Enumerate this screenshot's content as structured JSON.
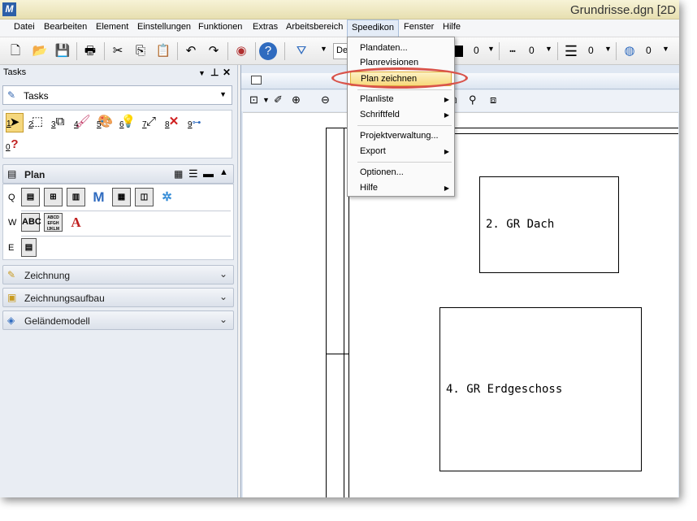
{
  "window": {
    "title": "Grundrisse.dgn [2D"
  },
  "menubar": {
    "items": [
      "Datei",
      "Bearbeiten",
      "Element",
      "Einstellungen",
      "Funktionen",
      "Extras",
      "Arbeitsbereich",
      "Speedikon",
      "Fenster",
      "Hilfe"
    ]
  },
  "toolbar": {
    "combo_text": "De",
    "values": [
      "0",
      "0",
      "0",
      "0"
    ],
    "icons": [
      "new-file-icon",
      "open-folder-icon",
      "save-icon",
      "print-icon",
      "cut-icon",
      "copy-icon",
      "paste-icon",
      "undo-icon",
      "redo-icon",
      "globe-icon",
      "help-icon",
      "level-icon"
    ]
  },
  "dropdown": {
    "items": [
      {
        "label": "Plandaten...",
        "submenu": false
      },
      {
        "label": "Planrevisionen",
        "submenu": false
      },
      {
        "label": "Plan zeichnen",
        "submenu": false,
        "highlighted": true
      },
      {
        "label": "Planliste",
        "submenu": true
      },
      {
        "label": "Schriftfeld",
        "submenu": true
      },
      {
        "label": "Projektverwaltung...",
        "submenu": false
      },
      {
        "label": "Export",
        "submenu": true
      },
      {
        "label": "Optionen...",
        "submenu": false
      },
      {
        "label": "Hilfe",
        "submenu": true
      }
    ]
  },
  "tasks": {
    "header": "Tasks",
    "selector": "Tasks",
    "tool_numbers": [
      "1",
      "2",
      "3",
      "4",
      "5",
      "6",
      "7",
      "8",
      "9",
      "0"
    ],
    "plan_section": {
      "title": "Plan",
      "rows": [
        "Q",
        "W",
        "E"
      ],
      "text_tool": "ABC",
      "text_font_tool": "ABCD EFGH IJKLM",
      "text_letter_tool": "A"
    },
    "collapsed_sections": [
      "Zeichnung",
      "Zeichnungsaufbau",
      "Geländemodell"
    ]
  },
  "drawing": {
    "boxes": [
      {
        "label": "2. GR Dach"
      },
      {
        "label": "4. GR Erdgeschoss"
      }
    ]
  },
  "colors": {
    "highlight_ring": "#d9534a",
    "menu_highlight": "#f7d97c",
    "title_bar": "#ece5bd"
  }
}
